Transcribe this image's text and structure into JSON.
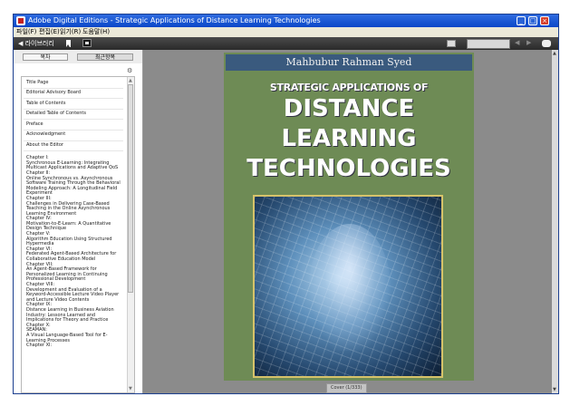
{
  "window": {
    "title": "Adobe Digital Editions - Strategic Applications of Distance Learning Technologies",
    "minimize": "_",
    "maximize": "□",
    "close": "×"
  },
  "menu": [
    "파일(F)",
    "편집(E)",
    "읽기(R)",
    "도움말(H)"
  ],
  "toolbar": {
    "library": "◀ 라이브러리",
    "prev": "◀",
    "next": "▶"
  },
  "sidebar": {
    "tab_contents": "목차",
    "tab_recent": "최근항목",
    "options": "⚙",
    "toc_items": [
      "Title Page",
      "Editorial Advisory Board",
      "Table of Contents",
      "Detailed Table of Contents",
      "Preface",
      "Acknowledgment",
      "About the Editor"
    ],
    "chapters": "Chapter I:\nSynchronous E-Learning: Integrating Multicast Applications and Adaptive QoS\nChapter II:\nOnline Synchronous vs. Asynchronous Software Training Through the Behavioral Modeling Approach: A Longitudinal Field Experiment\nChapter III:\nChallenges in Delivering Case-Based Teaching in the Online Asynchronous Learning Environment\nChapter IV:\nMotivation-to-E-Learn: A Quantitative Design Technique\nChapter V:\nAlgorithm Education Using Structured Hypermedia\nChapter VI:\nFederated Agent-Based Architecture for Collaborative Education Model\nChapter VII:\nAn Agent-Based Framework for Personalized Learning in Continuing Professional Development\nChapter VIII:\nDevelopment and Evaluation of a Keyword-Accessible Lecture Video Player and Lecture Video Contents\nChapter IX:\nDistance Learning in Business Aviation Industry: Lessons Learned and Implications for Theory and Practice\nChapter X:\nSEAMAN:\nA Visual Language-Based Tool for E-Learning Processes\nChapter XI:"
  },
  "cover": {
    "author": "Mahbubur Rahman Syed",
    "line1": "STRATEGIC APPLICATIONS OF",
    "big1": "DISTANCE",
    "big2": "LEARNING",
    "big3": "TECHNOLOGIES"
  },
  "page_indicator": "Cover (1/333)"
}
